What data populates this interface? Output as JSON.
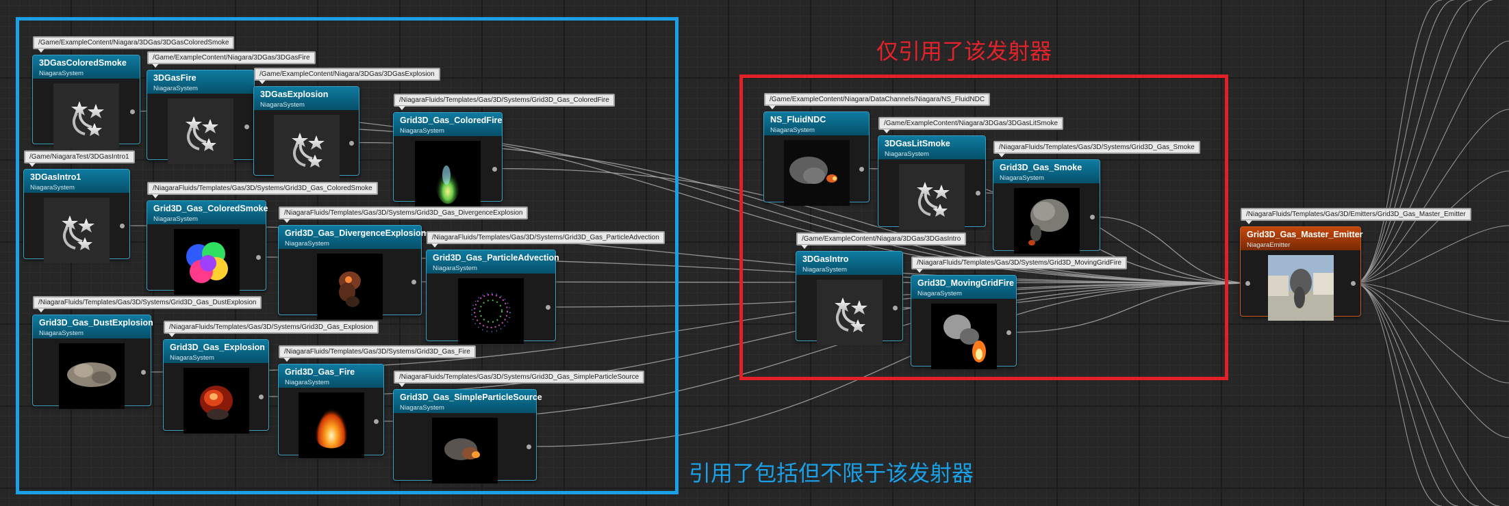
{
  "annotations": {
    "only_referenced": "仅引用了该发射器",
    "referenced_including": "引用了包括但不限于该发射器"
  },
  "colors": {
    "system_header": "#0b6a8c",
    "emitter_header": "#b5430b",
    "blue_frame": "#1aa0e6",
    "red_frame": "#e22027",
    "path_tag_bg": "#e9e9e9"
  },
  "nodes": [
    {
      "title": "3DGasColoredSmoke",
      "type": "NiagaraSystem",
      "path": "/Game/ExampleContent/Niagara/3DGas/3DGasColoredSmoke",
      "icon": "niagara-system-icon"
    },
    {
      "title": "3DGasFire",
      "type": "NiagaraSystem",
      "path": "/Game/ExampleContent/Niagara/3DGas/3DGasFire",
      "icon": "niagara-system-icon"
    },
    {
      "title": "3DGasExplosion",
      "type": "NiagaraSystem",
      "path": "/Game/ExampleContent/Niagara/3DGas/3DGasExplosion",
      "icon": "niagara-system-icon"
    },
    {
      "title": "Grid3D_Gas_ColoredFire",
      "type": "NiagaraSystem",
      "path": "/NiagaraFluids/Templates/Gas/3D/Systems/Grid3D_Gas_ColoredFire",
      "icon": "colored-fire-thumbnail"
    },
    {
      "title": "3DGasIntro1",
      "type": "NiagaraSystem",
      "path": "/Game/NiagaraTest/3DGasIntro1",
      "icon": "niagara-system-icon"
    },
    {
      "title": "Grid3D_Gas_ColoredSmoke",
      "type": "NiagaraSystem",
      "path": "/NiagaraFluids/Templates/Gas/3D/Systems/Grid3D_Gas_ColoredSmoke",
      "icon": "colored-smoke-thumbnail"
    },
    {
      "title": "Grid3D_Gas_DivergenceExplosion",
      "type": "NiagaraSystem",
      "path": "/NiagaraFluids/Templates/Gas/3D/Systems/Grid3D_Gas_DivergenceExplosion",
      "icon": "divergence-explosion-thumbnail"
    },
    {
      "title": "Grid3D_Gas_ParticleAdvection",
      "type": "NiagaraSystem",
      "path": "/NiagaraFluids/Templates/Gas/3D/Systems/Grid3D_Gas_ParticleAdvection",
      "icon": "particle-advection-thumbnail"
    },
    {
      "title": "Grid3D_Gas_DustExplosion",
      "type": "NiagaraSystem",
      "path": "/NiagaraFluids/Templates/Gas/3D/Systems/Grid3D_Gas_DustExplosion",
      "icon": "dust-explosion-thumbnail"
    },
    {
      "title": "Grid3D_Gas_Explosion",
      "type": "NiagaraSystem",
      "path": "/NiagaraFluids/Templates/Gas/3D/Systems/Grid3D_Gas_Explosion",
      "icon": "explosion-thumbnail"
    },
    {
      "title": "Grid3D_Gas_Fire",
      "type": "NiagaraSystem",
      "path": "/NiagaraFluids/Templates/Gas/3D/Systems/Grid3D_Gas_Fire",
      "icon": "fire-thumbnail"
    },
    {
      "title": "Grid3D_Gas_SimpleParticleSource",
      "type": "NiagaraSystem",
      "path": "/NiagaraFluids/Templates/Gas/3D/Systems/Grid3D_Gas_SimpleParticleSource",
      "icon": "simple-particle-source-thumbnail"
    },
    {
      "title": "NS_FluidNDC",
      "type": "NiagaraSystem",
      "path": "/Game/ExampleContent/Niagara/DataChannels/Niagara/NS_FluidNDC",
      "icon": "fluid-ndc-thumbnail"
    },
    {
      "title": "3DGasLitSmoke",
      "type": "NiagaraSystem",
      "path": "/Game/ExampleContent/Niagara/3DGas/3DGasLitSmoke",
      "icon": "niagara-system-icon"
    },
    {
      "title": "Grid3D_Gas_Smoke",
      "type": "NiagaraSystem",
      "path": "/NiagaraFluids/Templates/Gas/3D/Systems/Grid3D_Gas_Smoke",
      "icon": "smoke-thumbnail"
    },
    {
      "title": "3DGasIntro",
      "type": "NiagaraSystem",
      "path": "/Game/ExampleContent/Niagara/3DGas/3DGasIntro",
      "icon": "niagara-system-icon"
    },
    {
      "title": "Grid3D_MovingGridFire",
      "type": "NiagaraSystem",
      "path": "/NiagaraFluids/Templates/Gas/3D/Systems/Grid3D_MovingGridFire",
      "icon": "moving-grid-fire-thumbnail"
    },
    {
      "title": "Grid3D_Gas_Master_Emitter",
      "type": "NiagaraEmitter",
      "path": "/NiagaraFluids/Templates/Gas/3D/Emitters/Grid3D_Gas_Master_Emitter",
      "icon": "master-emitter-thumbnail"
    }
  ]
}
